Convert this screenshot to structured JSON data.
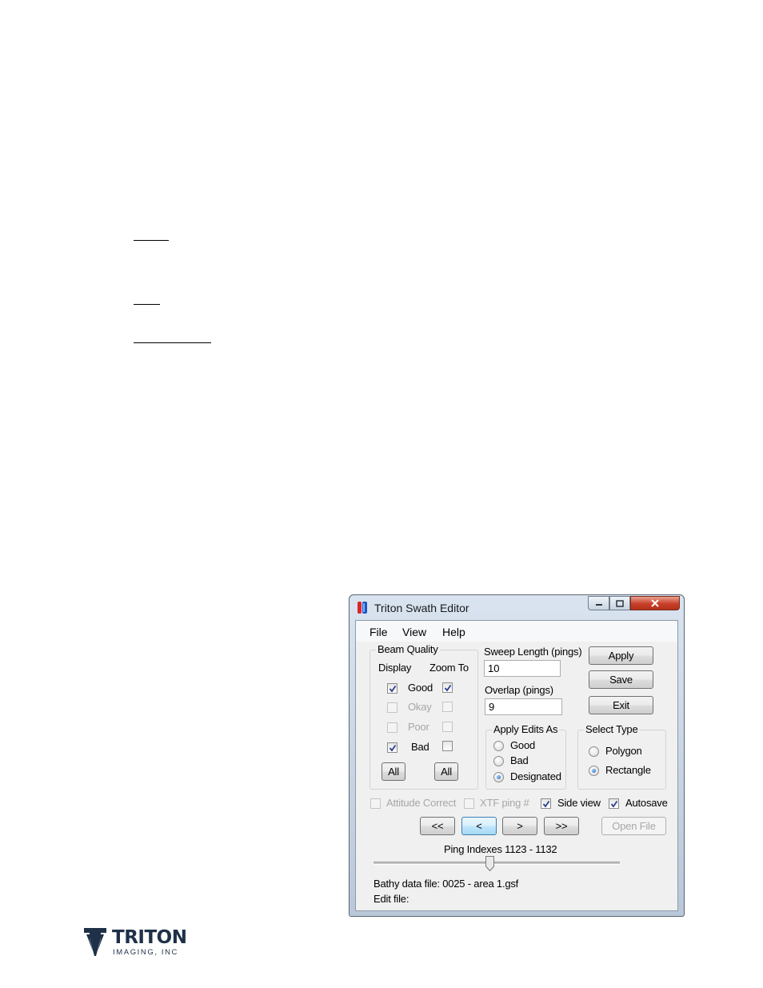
{
  "window": {
    "title": "Triton Swath Editor",
    "icon": "triton-app-icon",
    "controls": [
      "minimize-icon",
      "maximize-icon",
      "close-icon"
    ]
  },
  "menu": [
    "File",
    "View",
    "Help"
  ],
  "beam_quality": {
    "label": "Beam Quality",
    "display_header": "Display",
    "zoom_header": "Zoom To",
    "rows": [
      {
        "label": "Good",
        "display": true,
        "zoom": true,
        "enabled": true
      },
      {
        "label": "Okay",
        "display": false,
        "zoom": false,
        "enabled": false
      },
      {
        "label": "Poor",
        "display": false,
        "zoom": false,
        "enabled": false
      },
      {
        "label": "Bad",
        "display": true,
        "zoom": false,
        "enabled": true
      }
    ],
    "all_label": "All"
  },
  "sweep": {
    "label": "Sweep Length (pings)",
    "value": "10"
  },
  "overlap": {
    "label": "Overlap (pings)",
    "value": "9"
  },
  "buttons": {
    "apply": "Apply",
    "save": "Save",
    "exit": "Exit"
  },
  "apply_edits": {
    "label": "Apply Edits As",
    "options": [
      "Good",
      "Bad",
      "Designated"
    ],
    "selected": "Designated"
  },
  "select_type": {
    "label": "Select Type",
    "options": [
      "Polygon",
      "Rectangle"
    ],
    "selected": "Rectangle"
  },
  "options_row": [
    {
      "label": "Attitude Correct",
      "checked": false,
      "enabled": false
    },
    {
      "label": "XTF ping #",
      "checked": false,
      "enabled": false
    },
    {
      "label": "Side view",
      "checked": true,
      "enabled": true
    },
    {
      "label": "Autosave",
      "checked": true,
      "enabled": true
    }
  ],
  "nav": {
    "first": "<<",
    "prev": "<",
    "next": ">",
    "last": ">>",
    "open_file": "Open File"
  },
  "ping_indexes": "Ping Indexes 1123 - 1132",
  "slider": {
    "position": 0.47
  },
  "bathy_file": "Bathy data file: 0025 - area 1.gsf",
  "edit_file": "Edit file:",
  "logo": {
    "name": "TRITON",
    "sub": "IMAGING, INC"
  },
  "colors": {
    "accent": "#1f5fb0",
    "logo": "#1e3148",
    "close": "#c9402a"
  }
}
